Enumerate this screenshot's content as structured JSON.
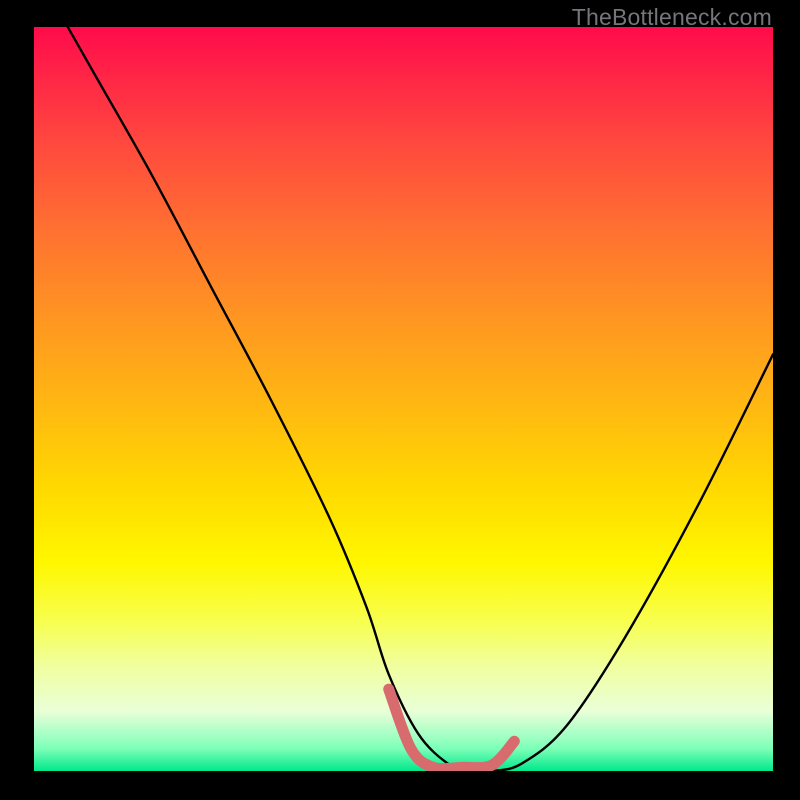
{
  "watermark": "TheBottleneck.com",
  "chart_data": {
    "type": "line",
    "title": "",
    "xlabel": "",
    "ylabel": "",
    "xlim": [
      0,
      100
    ],
    "ylim": [
      0,
      100
    ],
    "grid": false,
    "series": [
      {
        "name": "bottleneck-curve",
        "x": [
          0,
          8,
          16,
          24,
          32,
          40,
          45,
          48,
          52,
          56,
          59,
          62,
          66,
          72,
          80,
          90,
          100
        ],
        "y": [
          108,
          94,
          80,
          65,
          50,
          34,
          22,
          13,
          5,
          1,
          0,
          0,
          1,
          6,
          18,
          36,
          56
        ],
        "color": "#000000"
      }
    ],
    "annotations": [
      {
        "name": "bottom-highlight",
        "type": "segment",
        "color": "#d86b6e",
        "x": [
          48,
          51,
          54,
          58,
          62,
          65
        ],
        "y": [
          11,
          3,
          0.5,
          0.5,
          0.8,
          4
        ]
      }
    ],
    "gradient_stops": [
      {
        "pos": 0,
        "color": "#ff0b4b"
      },
      {
        "pos": 16,
        "color": "#ff4a3e"
      },
      {
        "pos": 40,
        "color": "#ff9820"
      },
      {
        "pos": 62,
        "color": "#ffd900"
      },
      {
        "pos": 80,
        "color": "#f7ff50"
      },
      {
        "pos": 97,
        "color": "#7cffb8"
      },
      {
        "pos": 100,
        "color": "#00e98b"
      }
    ]
  }
}
